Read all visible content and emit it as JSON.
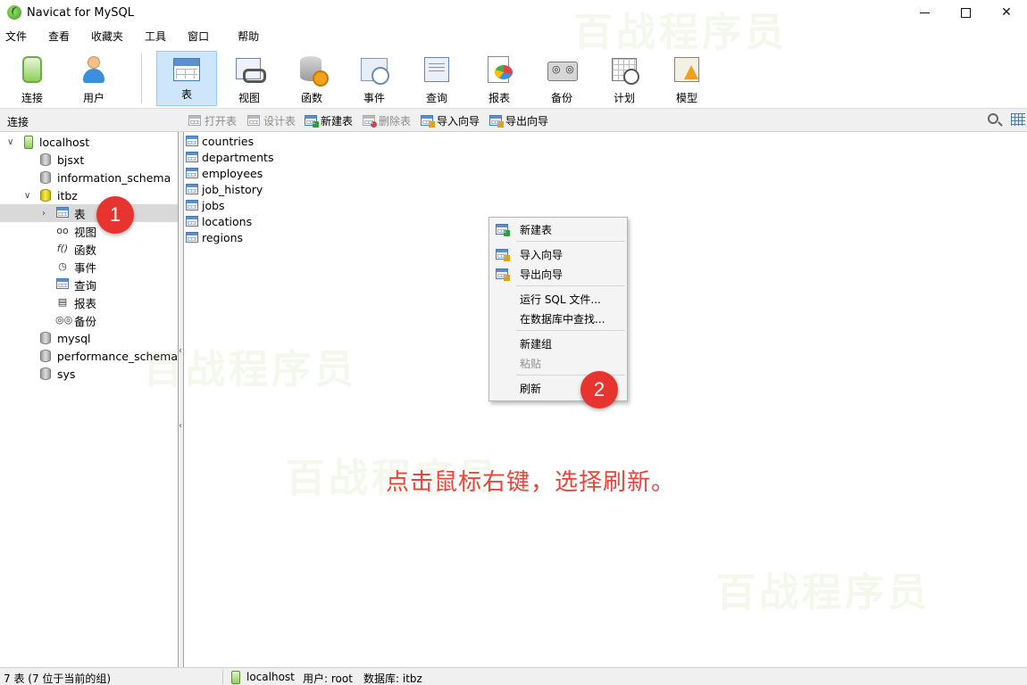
{
  "window": {
    "title": "Navicat for MySQL",
    "controls": [
      "minimize",
      "maximize",
      "close"
    ]
  },
  "menu": [
    "文件",
    "查看",
    "收藏夹",
    "工具",
    "窗口",
    "帮助"
  ],
  "toolbar": {
    "items": [
      {
        "label": "连接",
        "icon": "connection-icon",
        "active": false
      },
      {
        "label": "用户",
        "icon": "user-icon",
        "active": false
      },
      {
        "label": "表",
        "icon": "table-icon",
        "active": true
      },
      {
        "label": "视图",
        "icon": "view-icon",
        "active": false
      },
      {
        "label": "函数",
        "icon": "function-icon",
        "active": false
      },
      {
        "label": "事件",
        "icon": "event-icon",
        "active": false
      },
      {
        "label": "查询",
        "icon": "query-icon",
        "active": false
      },
      {
        "label": "报表",
        "icon": "report-icon",
        "active": false
      },
      {
        "label": "备份",
        "icon": "backup-icon",
        "active": false
      },
      {
        "label": "计划",
        "icon": "schedule-icon",
        "active": false
      },
      {
        "label": "模型",
        "icon": "model-icon",
        "active": false
      }
    ]
  },
  "subbar": {
    "panel_label": "连接",
    "buttons": [
      {
        "label": "打开表",
        "enabled": false
      },
      {
        "label": "设计表",
        "enabled": false
      },
      {
        "label": "新建表",
        "enabled": true
      },
      {
        "label": "删除表",
        "enabled": false
      },
      {
        "label": "导入向导",
        "enabled": true
      },
      {
        "label": "导出向导",
        "enabled": true
      }
    ]
  },
  "tree": {
    "connection": "localhost",
    "databases": [
      "bjsxt",
      "information_schema",
      "itbz",
      "mysql",
      "performance_schema",
      "sys"
    ],
    "open_database": "itbz",
    "nodes": [
      {
        "label": "表",
        "icon": "table-icon",
        "selected": true
      },
      {
        "label": "视图",
        "icon": "view-icon",
        "selected": false
      },
      {
        "label": "函数",
        "icon": "function-icon",
        "selected": false
      },
      {
        "label": "事件",
        "icon": "event-icon",
        "selected": false
      },
      {
        "label": "查询",
        "icon": "query-icon",
        "selected": false
      },
      {
        "label": "报表",
        "icon": "report-icon",
        "selected": false
      },
      {
        "label": "备份",
        "icon": "backup-icon",
        "selected": false
      }
    ]
  },
  "tables": [
    "countries",
    "departments",
    "employees",
    "job_history",
    "jobs",
    "locations",
    "regions"
  ],
  "context_menu": [
    {
      "label": "新建表",
      "icon": "new-table-icon",
      "enabled": true
    },
    {
      "label": "导入向导",
      "icon": "import-icon",
      "enabled": true
    },
    {
      "label": "导出向导",
      "icon": "export-icon",
      "enabled": true
    },
    {
      "label": "运行 SQL 文件...",
      "enabled": true
    },
    {
      "label": "在数据库中查找...",
      "enabled": true
    },
    {
      "label": "新建组",
      "enabled": true
    },
    {
      "label": "粘贴",
      "enabled": false
    },
    {
      "label": "刷新",
      "enabled": true
    }
  ],
  "markers": [
    "1",
    "2"
  ],
  "annotation": "点击鼠标右键，选择刷新。",
  "watermark": "百战程序员",
  "status": {
    "count": "7 表 (7 位于当前的组)",
    "connection": "localhost",
    "user": "用户: root",
    "database": "数据库: itbz"
  },
  "colors": {
    "accent_active": "#cde6fb",
    "marker": "#e8342f",
    "annotation": "#e8443a"
  }
}
